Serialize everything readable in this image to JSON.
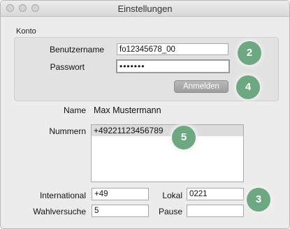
{
  "window": {
    "title": "Einstellungen"
  },
  "konto": {
    "section_label": "Konto",
    "username_label": "Benutzername",
    "username_value": "fo12345678_00",
    "password_label": "Passwort",
    "password_value": "•••••••",
    "login_button": "Anmelden"
  },
  "details": {
    "name_label": "Name",
    "name_value": "Max Mustermann",
    "numbers_label": "Nummern",
    "numbers": [
      "+49221123456789"
    ],
    "international_label": "International",
    "international_value": "+49",
    "local_label": "Lokal",
    "local_value": "0221",
    "retries_label": "Wahlversuche",
    "retries_value": "5",
    "pause_label": "Pause",
    "pause_value": ""
  },
  "badges": {
    "b2": "2",
    "b3": "3",
    "b4": "4",
    "b5": "5"
  },
  "colors": {
    "badge": "#6ea882",
    "window_bg": "#ececec",
    "button": "#a8a8a8"
  }
}
